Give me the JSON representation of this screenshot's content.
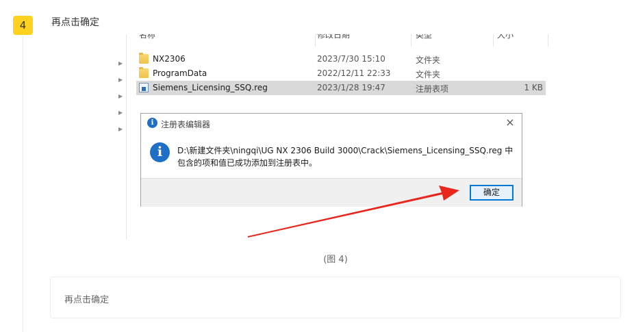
{
  "step": {
    "number": "4",
    "title": "再点击确定"
  },
  "file_list": {
    "columns": [
      "名称",
      "修改日期",
      "类型",
      "大小"
    ],
    "rows": [
      {
        "name": "NX2306",
        "date": "2023/7/30 15:10",
        "type": "文件夹",
        "size": "",
        "icon": "folder-icon"
      },
      {
        "name": "ProgramData",
        "date": "2022/12/11 22:33",
        "type": "文件夹",
        "size": "",
        "icon": "folder-icon"
      },
      {
        "name": "Siemens_Licensing_SSQ.reg",
        "date": "2023/1/28 19:47",
        "type": "注册表项",
        "size": "1 KB",
        "icon": "registry-file-icon"
      }
    ]
  },
  "dialog": {
    "title": "注册表编辑器",
    "message": "D:\\新建文件夹\\ningqi\\UG NX 2306 Build 3000\\Crack\\Siemens_Licensing_SSQ.reg 中包含的项和值已成功添加到注册表中。",
    "ok_label": "确定",
    "close_glyph": "×",
    "info_glyph": "i"
  },
  "arrow_color": "#e8261c",
  "caption": "(图 4)",
  "note": "再点击确定",
  "colors": {
    "step_badge": "#ffd21f",
    "dialog_accent": "#0078d7",
    "info_icon": "#1f6fc5"
  }
}
